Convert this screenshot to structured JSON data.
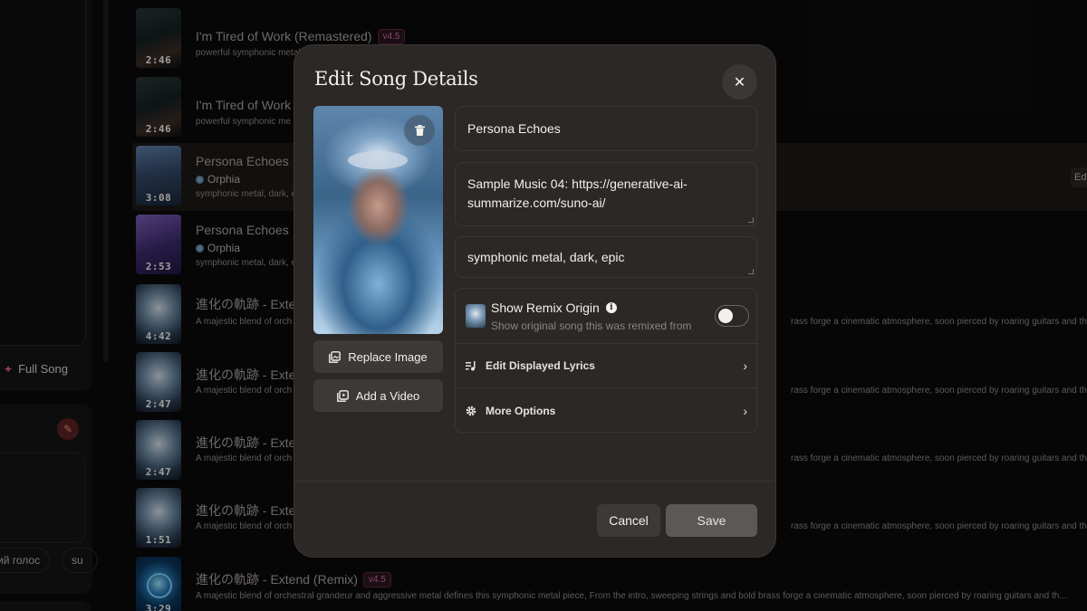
{
  "sidebar": {
    "full_song_label": "Full Song",
    "chips": [
      "ий голос",
      "su"
    ]
  },
  "songs": [
    {
      "title": "I'm Tired of Work (Remastered)",
      "badge": "v4.5",
      "artist": "",
      "desc": "powerful symphonic metal",
      "desc_right": "",
      "duration": "2:46"
    },
    {
      "title": "I'm Tired of Work (",
      "badge": "",
      "artist": "",
      "desc": "powerful symphonic me",
      "desc_right": "",
      "duration": "2:46"
    },
    {
      "title": "Persona Echoes",
      "badge": "",
      "artist": "Orphia",
      "desc": "symphonic metal, dark, e",
      "desc_right": "",
      "duration": "3:08"
    },
    {
      "title": "Persona Echoes",
      "badge": "",
      "artist": "Orphia",
      "desc": "symphonic metal, dark, e",
      "desc_right": "",
      "duration": "2:53"
    },
    {
      "title": "進化の軌跡 - Exte",
      "badge": "",
      "artist": "",
      "desc": "A majestic blend of orch",
      "desc_right": "rass forge a cinematic atmosphere, soon pierced by roaring guitars and th...",
      "duration": "4:42"
    },
    {
      "title": "進化の軌跡 - Exte",
      "badge": "",
      "artist": "",
      "desc": "A majestic blend of orch",
      "desc_right": "rass forge a cinematic atmosphere, soon pierced by roaring guitars and th...",
      "duration": "2:47"
    },
    {
      "title": "進化の軌跡 - Exte",
      "badge": "",
      "artist": "",
      "desc": "A majestic blend of orch",
      "desc_right": "rass forge a cinematic atmosphere, soon pierced by roaring guitars and th...",
      "duration": "2:47"
    },
    {
      "title": "進化の軌跡 - Exte",
      "badge": "",
      "artist": "",
      "desc": "A majestic blend of orch",
      "desc_right": "rass forge a cinematic atmosphere, soon pierced by roaring guitars and th...",
      "duration": "1:51"
    },
    {
      "title": "進化の軌跡 - Extend (Remix)",
      "badge": "v4.5",
      "artist": "",
      "desc": "A majestic blend of orchestral grandeur and aggressive metal defines this symphonic metal piece, From the intro, sweeping strings and bold brass forge a cinematic atmosphere, soon pierced by roaring guitars and th...",
      "desc_right": "",
      "duration": "3:29"
    }
  ],
  "edit_peek": "Ed",
  "modal": {
    "title": "Edit Song Details",
    "close_icon": "close-icon",
    "replace_image_label": "Replace Image",
    "add_video_label": "Add a Video",
    "song_title_value": "Persona Echoes",
    "description_value": "Sample Music 04: https://generative-ai-summarize.com/suno-ai/",
    "style_value": "symphonic metal, dark, epic",
    "remix_origin": {
      "title": "Show Remix Origin",
      "subtitle": "Show original song this was remixed from",
      "enabled": false
    },
    "edit_lyrics_label": "Edit Displayed Lyrics",
    "more_options_label": "More Options",
    "cancel_label": "Cancel",
    "save_label": "Save"
  },
  "colors": {
    "modal_bg": "#2b2826",
    "page_bg": "#0b0a0a",
    "badge": "#d86aa2",
    "save_bg": "#5c5856"
  }
}
